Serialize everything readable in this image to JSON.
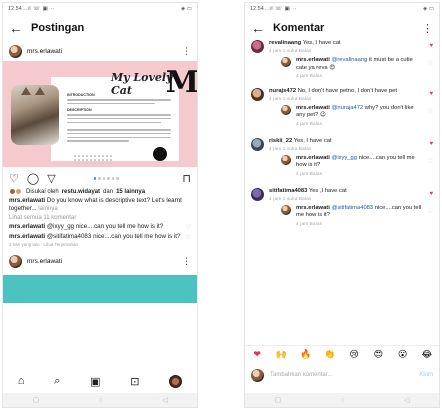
{
  "left": {
    "status": {
      "time": "12.54",
      "signal": "..ıl ☏ ▣ ··",
      "battery": "◈ ▭"
    },
    "header": {
      "title": "Postingan"
    },
    "post": {
      "author": "mrs.erlawati",
      "image": {
        "heading": "My Lovely Cat",
        "section_intro": "INTRODUCTION",
        "section_desc": "DESCRIPTION"
      },
      "likes_prefix": "Disukai oleh",
      "likes_user": "restu.widayat",
      "likes_join": "dan",
      "likes_count": "15 lainnya",
      "caption_user": "mrs.erlawati",
      "caption_text": "Do you know what is descriptive text? Let's learnt together...",
      "caption_more": "lainnya",
      "view_all": "Lihat semua 11 komentar",
      "comments": [
        {
          "user": "mrs.erlawati",
          "mention": "@ixyy_gg",
          "text": "nice....can you tell me how is it?"
        },
        {
          "user": "mrs.erlawati",
          "mention": "@sitifatima4083",
          "text": "nice....can you tell me how is it?"
        }
      ],
      "time_small": "1 hari yang lalu · Lihat Terjemahan"
    },
    "post2": {
      "author": "mrs.erlawati"
    }
  },
  "right": {
    "status": {
      "time": "12.54",
      "signal": "..ıl ☏ ▣ ··",
      "battery": "◈ ▭"
    },
    "header": {
      "title": "Komentar"
    },
    "comments": [
      {
        "user": "revalinaang",
        "mention": "",
        "text": "Yes, I have cat",
        "meta": "4 jam   1 suka   Balas",
        "heart": "red",
        "reply": false
      },
      {
        "user": "mrs.erlawati",
        "mention": "@revalinaang",
        "text": "it must be a cutie cate ya reva 😍",
        "meta": "4 jam   Balas",
        "heart": "grey",
        "reply": true
      },
      {
        "user": "nurajs472",
        "mention": "",
        "text": "No, I don't have petno, I don't have pet",
        "meta": "4 jam   1 suka   Balas",
        "heart": "red",
        "reply": false
      },
      {
        "user": "mrs.erlawati",
        "mention": "@nuraja472",
        "text": "why? you don't like any pet? 😉",
        "meta": "4 jam   Balas",
        "heart": "grey",
        "reply": true
      },
      {
        "user": "riskii_22",
        "mention": "",
        "text": "Yes, I have cat",
        "meta": "4 jam   1 suka   Balas",
        "heart": "red",
        "reply": false
      },
      {
        "user": "mrs.erlawati",
        "mention": "@ixyy_gg",
        "text": "nice....can you tell me how is it?",
        "meta": "4 jam   Balas",
        "heart": "grey",
        "reply": true
      },
      {
        "user": "sitifatima4083",
        "mention": "",
        "text": "Yes ,I have cat",
        "meta": "4 jam   1 suka   Balas",
        "heart": "red",
        "reply": false
      },
      {
        "user": "mrs.erlawati",
        "mention": "@sitifatima4083",
        "text": "nice....can you tell me how is it?",
        "meta": "4 jam   Balas",
        "heart": "grey",
        "reply": true
      }
    ],
    "emojis": [
      "❤",
      "🙌",
      "🔥",
      "👏",
      "😢",
      "😍",
      "😮",
      "😂"
    ],
    "composer": {
      "placeholder": "Tambahkan komentar...",
      "send": "Kirim"
    }
  }
}
